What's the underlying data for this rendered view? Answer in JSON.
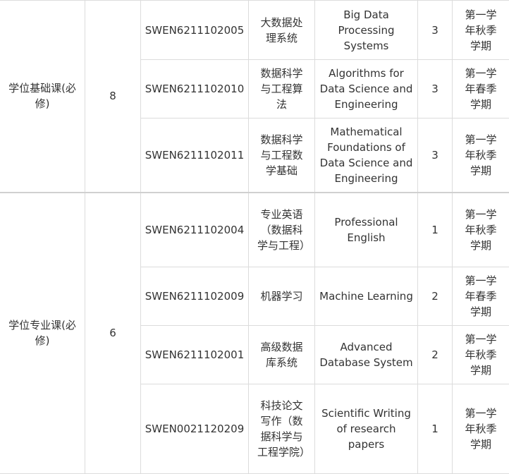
{
  "groups": [
    {
      "category": "学位基础课(必修)",
      "credits": "8",
      "courses": [
        {
          "code": "SWEN6211102005",
          "name_cn": "大数据处理系统",
          "name_en": "Big Data Processing Systems",
          "credit": "3",
          "term": "第一学年秋季学期"
        },
        {
          "code": "SWEN6211102010",
          "name_cn": "数据科学与工程算法",
          "name_en": "Algorithms for Data Science and Engineering",
          "credit": "3",
          "term": "第一学年春季学期"
        },
        {
          "code": "SWEN6211102011",
          "name_cn": "数据科学与工程数学基础",
          "name_en": "Mathematical Foundations of Data Science and Engineering",
          "credit": "3",
          "term": "第一学年秋季学期"
        }
      ]
    },
    {
      "category": "学位专业课(必修)",
      "credits": "6",
      "courses": [
        {
          "code": "SWEN6211102004",
          "name_cn": "专业英语（数据科学与工程）",
          "name_en": "Professional English",
          "credit": "1",
          "term": "第一学年秋季学期"
        },
        {
          "code": "SWEN6211102009",
          "name_cn": "机器学习",
          "name_en": "Machine Learning",
          "credit": "2",
          "term": "第一学年春季学期"
        },
        {
          "code": "SWEN6211102001",
          "name_cn": "高级数据库系统",
          "name_en": "Advanced Database System",
          "credit": "2",
          "term": "第一学年秋季学期"
        },
        {
          "code": "SWEN0021120209",
          "name_cn": "科技论文写作（数据科学与工程学院）",
          "name_en": "Scientific Writing of research papers",
          "credit": "1",
          "term": "第一学年秋季学期"
        }
      ]
    }
  ]
}
